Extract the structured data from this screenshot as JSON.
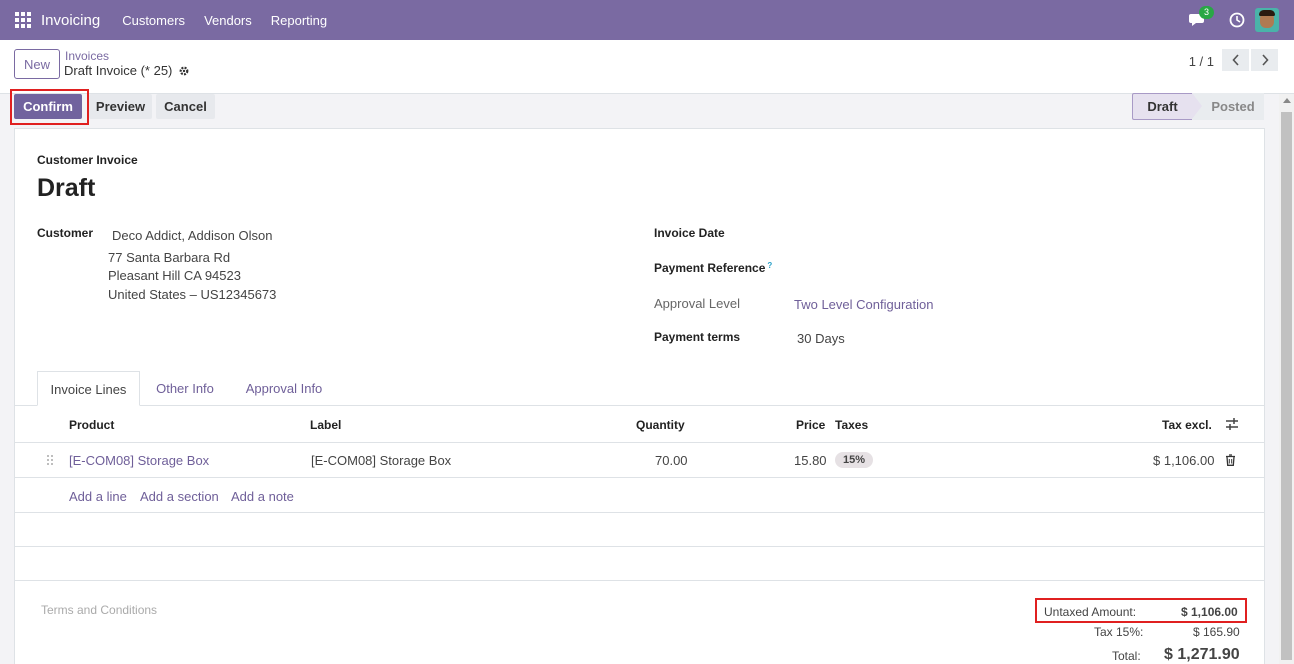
{
  "navbar": {
    "brand": "Invoicing",
    "menu": [
      "Customers",
      "Vendors",
      "Reporting"
    ],
    "chat_badge": "3"
  },
  "control_panel": {
    "new_label": "New",
    "breadcrumb_link": "Invoices",
    "breadcrumb_current": "Draft Invoice (* 25)",
    "pager": "1 / 1"
  },
  "actions": {
    "confirm": "Confirm",
    "preview": "Preview",
    "cancel": "Cancel"
  },
  "status": {
    "steps": [
      "Draft",
      "Posted"
    ],
    "active": "Draft"
  },
  "invoice": {
    "doc_type": "Customer Invoice",
    "title": "Draft",
    "customer_label": "Customer",
    "customer_name": "Deco Addict, Addison Olson",
    "address_line1": "77 Santa Barbara Rd",
    "address_line2": "Pleasant Hill CA 94523",
    "address_line3": "United States – US12345673",
    "invoice_date_label": "Invoice Date",
    "payment_ref_label": "Payment Reference",
    "payment_ref_help": "?",
    "approval_level_label": "Approval Level",
    "approval_level_value": "Two Level Configuration",
    "payment_terms_label": "Payment terms",
    "payment_terms_value": "30 Days"
  },
  "tabs": [
    "Invoice Lines",
    "Other Info",
    "Approval Info"
  ],
  "lines": {
    "headers": {
      "product": "Product",
      "label": "Label",
      "quantity": "Quantity",
      "price": "Price",
      "taxes": "Taxes",
      "tax_excl": "Tax excl."
    },
    "rows": [
      {
        "product": "[E-COM08] Storage Box",
        "label": "[E-COM08] Storage Box",
        "quantity": "70.00",
        "price": "15.80",
        "taxes": "15%",
        "subtotal": "$ 1,106.00"
      }
    ],
    "add_line": "Add a line",
    "add_section": "Add a section",
    "add_note": "Add a note"
  },
  "terms_placeholder": "Terms and Conditions",
  "totals": {
    "untaxed_label": "Untaxed Amount:",
    "untaxed_value": "$ 1,106.00",
    "tax_label": "Tax 15%:",
    "tax_value": "$ 165.90",
    "total_label": "Total:",
    "total_value": "$ 1,271.90"
  },
  "colors": {
    "brand": "#7a6aa2",
    "primary_button": "#71639e",
    "highlight": "#e02020"
  }
}
